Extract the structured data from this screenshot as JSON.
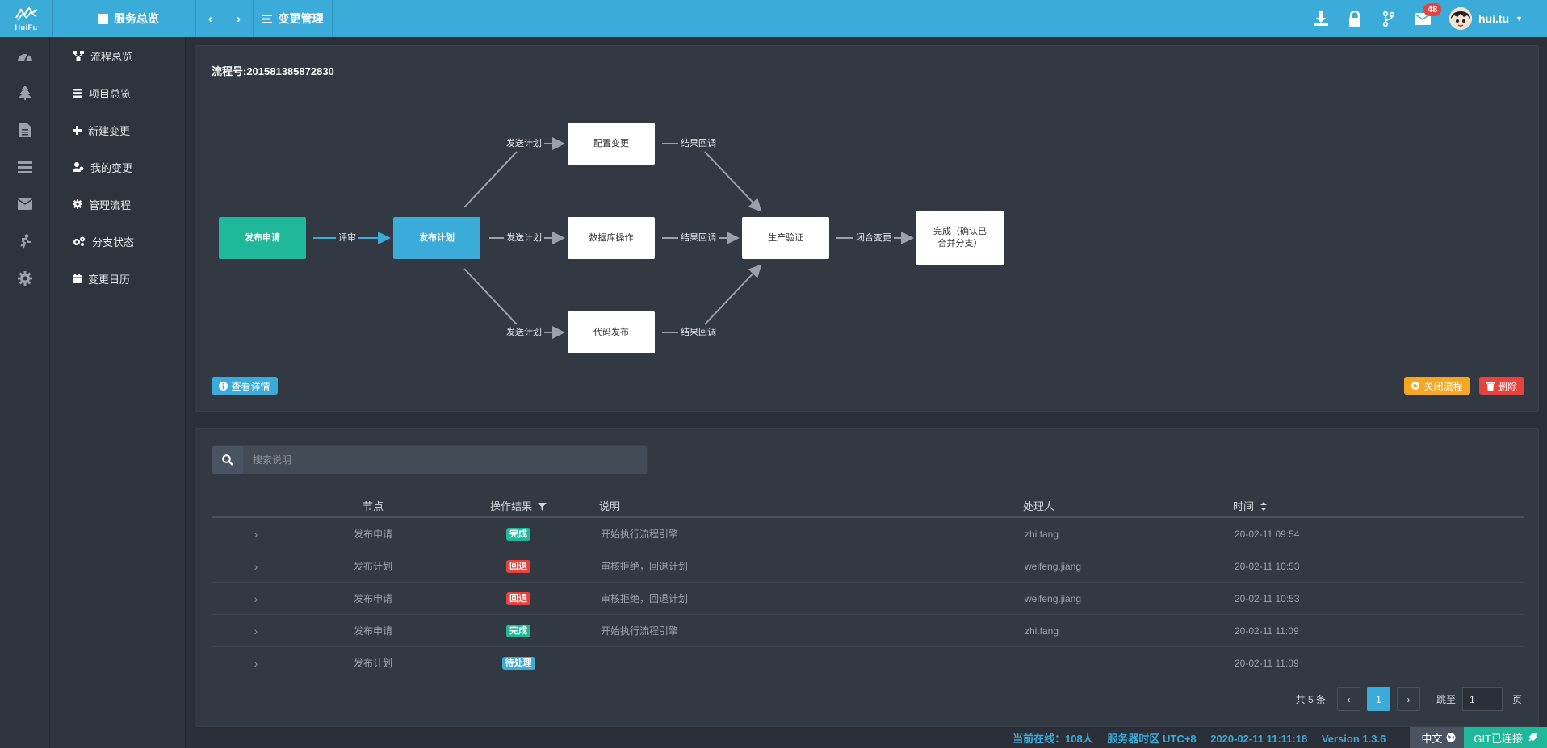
{
  "app": {
    "logo_text": "HuiFu"
  },
  "topbar": {
    "module_label": "服务总览",
    "page_label": "变更管理",
    "mail_badge": "48",
    "username": "hui.tu"
  },
  "menu": {
    "items": [
      {
        "label": "流程总览",
        "icon": "sitemap-icon"
      },
      {
        "label": "项目总览",
        "icon": "tasks-icon"
      },
      {
        "label": "新建变更",
        "icon": "plus-icon"
      },
      {
        "label": "我的变更",
        "icon": "user-icon"
      },
      {
        "label": "管理流程",
        "icon": "cog-icon"
      },
      {
        "label": "分支状态",
        "icon": "cogs-icon"
      },
      {
        "label": "变更日历",
        "icon": "calendar-icon"
      }
    ]
  },
  "flow": {
    "title": "流程号:201581385872830",
    "nodes": {
      "apply": "发布申请",
      "plan": "发布计划",
      "config": "配置变更",
      "db": "数据库操作",
      "code": "代码发布",
      "verify": "生产验证",
      "done_line1": "完成（确认已",
      "done_line2": "合并分支）"
    },
    "edges": {
      "review": "评审",
      "send_plan": "发送计划",
      "callback": "结果回调",
      "close_change": "闭合变更"
    },
    "buttons": {
      "detail": "查看详情",
      "close": "关闭流程",
      "delete": "删除"
    }
  },
  "table": {
    "search_placeholder": "搜索说明",
    "headers": {
      "node": "节点",
      "result": "操作结果",
      "desc": "说明",
      "handler": "处理人",
      "time": "时间"
    },
    "rows": [
      {
        "node": "发布申请",
        "result": "完成",
        "status": "done",
        "desc": "开始执行流程引擎",
        "handler": "zhi.fang",
        "time": "20-02-11 09:54"
      },
      {
        "node": "发布计划",
        "result": "回退",
        "status": "back",
        "desc": "审核拒绝，回退计划",
        "handler": "weifeng.jiang",
        "time": "20-02-11 10:53"
      },
      {
        "node": "发布申请",
        "result": "回退",
        "status": "back",
        "desc": "审核拒绝，回退计划",
        "handler": "weifeng.jiang",
        "time": "20-02-11 10:53"
      },
      {
        "node": "发布申请",
        "result": "完成",
        "status": "done",
        "desc": "开始执行流程引擎",
        "handler": "zhi.fang",
        "time": "20-02-11 11:09"
      },
      {
        "node": "发布计划",
        "result": "待处理",
        "status": "wait",
        "desc": "",
        "handler": "",
        "time": "20-02-11 11:09"
      }
    ],
    "pagination": {
      "total_text": "共 5 条",
      "current_page": "1",
      "jump_label": "跳至",
      "jump_value": "1",
      "page_suffix": "页"
    }
  },
  "footer": {
    "online": "当前在线：108人",
    "timezone": "服务器时区 UTC+8",
    "datetime": "2020-02-11 11:11:18",
    "version": "Version 1.3.6",
    "language": "中文",
    "git_status": "GIT已连接"
  },
  "colors": {
    "accent": "#3babd9",
    "success": "#1fb89a",
    "danger": "#e8423f",
    "warning": "#f5a623"
  }
}
